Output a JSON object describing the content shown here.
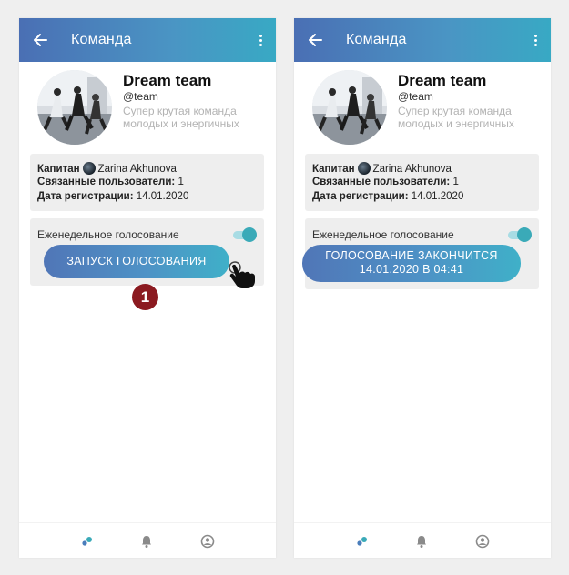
{
  "screens": [
    {
      "appbar": {
        "title": "Команда"
      },
      "team": {
        "name": "Dream team",
        "handle": "@team",
        "description": "Супер крутая команда молодых и энергичных"
      },
      "info": {
        "captain_label": "Капитан",
        "captain_name": "Zarina Akhunova",
        "linked_label": "Связанные пользователи:",
        "linked_value": "1",
        "reg_label": "Дата регистрации:",
        "reg_value": "14.01.2020"
      },
      "vote": {
        "label": "Еженедельное голосование",
        "toggle_on": true,
        "button_label": "ЗАПУСК ГОЛОСОВАНИЯ"
      }
    },
    {
      "appbar": {
        "title": "Команда"
      },
      "team": {
        "name": "Dream team",
        "handle": "@team",
        "description": "Супер крутая команда молодых и энергичных"
      },
      "info": {
        "captain_label": "Капитан",
        "captain_name": "Zarina Akhunova",
        "linked_label": "Связанные пользователи:",
        "linked_value": "1",
        "reg_label": "Дата регистрации:",
        "reg_value": "14.01.2020"
      },
      "vote": {
        "label": "Еженедельное голосование",
        "toggle_on": true,
        "button_line1": "ГОЛОСОВАНИЕ ЗАКОНЧИТСЯ",
        "button_line2": "14.01.2020 В 04:41"
      }
    }
  ],
  "step_badge": "1",
  "icons": [
    "back-arrow-icon",
    "more-vert-icon",
    "team-icon",
    "bell-icon",
    "profile-icon",
    "hand-pointer-icon"
  ],
  "colors": {
    "accent": "#3aaab8",
    "badge": "#8b1a20"
  }
}
